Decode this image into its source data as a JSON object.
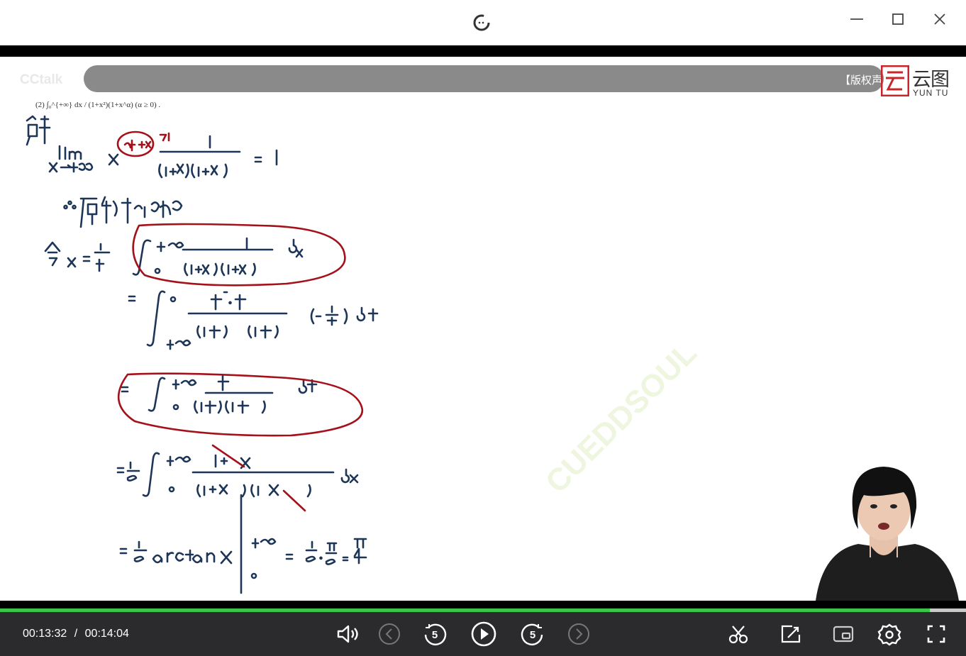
{
  "notice": {
    "text": "【版权声"
  },
  "brand": {
    "cn": "云图",
    "en": "YUN TU"
  },
  "watermark_logo": "CCtalk",
  "watermark_text": "CUEDDSOUL",
  "question": {
    "text": "(2) ∫₀^{+∞} dx / (1+x²)(1+x^α) (α ≥ 0) ."
  },
  "player": {
    "current_time": "00:13:32",
    "separator": "/",
    "total_time": "00:14:04",
    "progress": 0.9624,
    "accent": "#38c74a",
    "icons": [
      "volume-icon",
      "previous-icon",
      "rewind-5-icon",
      "play-icon",
      "forward-5-icon",
      "next-icon",
      "clip-icon",
      "share-icon",
      "picture-in-picture-icon",
      "settings-icon",
      "fullscreen-icon"
    ]
  },
  "window": {
    "icons": [
      "app-logo-icon",
      "minimize-icon",
      "maximize-icon",
      "close-icon"
    ]
  }
}
